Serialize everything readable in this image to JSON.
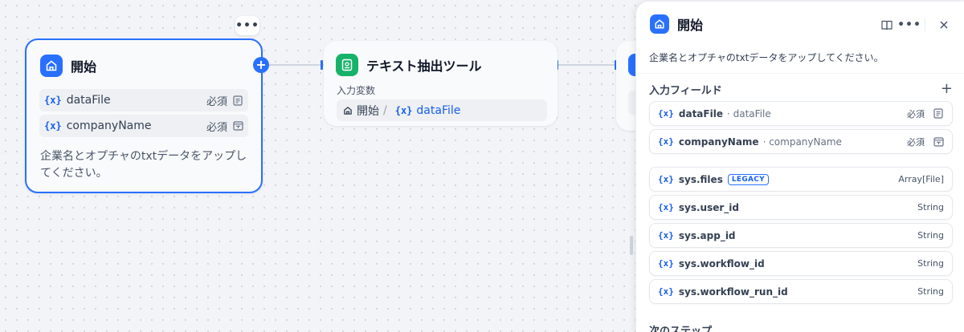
{
  "colors": {
    "accent": "#2970ff",
    "start_icon_bg": "#2970ff",
    "extract_icon_bg": "#17b26a",
    "var_token": "#155eef"
  },
  "start_node": {
    "title": "開始",
    "more_label": "•••",
    "plus_label": "+",
    "variables": [
      {
        "token": "{x}",
        "name": "dataFile",
        "required": "必須",
        "type_icon": "document-icon"
      },
      {
        "token": "{x}",
        "name": "companyName",
        "required": "必須",
        "type_icon": "text-field-icon"
      }
    ],
    "description": "企業名とオプチャのtxtデータをアップしてください。"
  },
  "extract_node": {
    "title": "テキスト抽出ツール",
    "input_label": "入力変数",
    "ref": {
      "node": "開始",
      "separator": "/",
      "token": "{x}",
      "var": "dataFile"
    }
  },
  "panel": {
    "title": "開始",
    "description": "企業名とオプチャのtxtデータをアップしてください。",
    "input_section": "入力フィールド",
    "add_label": "+",
    "fields": [
      {
        "token": "{x}",
        "name": "dataFile",
        "sub": "· dataFile",
        "right": "必須",
        "type_icon": "document-icon"
      },
      {
        "token": "{x}",
        "name": "companyName",
        "sub": "· companyName",
        "right": "必須",
        "type_icon": "text-field-icon"
      }
    ],
    "sys_fields": [
      {
        "token": "{x}",
        "name": "sys.files",
        "badge": "LEGACY",
        "right": "Array[File]"
      },
      {
        "token": "{x}",
        "name": "sys.user_id",
        "right": "String"
      },
      {
        "token": "{x}",
        "name": "sys.app_id",
        "right": "String"
      },
      {
        "token": "{x}",
        "name": "sys.workflow_id",
        "right": "String"
      },
      {
        "token": "{x}",
        "name": "sys.workflow_run_id",
        "right": "String"
      }
    ],
    "next_step": "次のステップ"
  }
}
